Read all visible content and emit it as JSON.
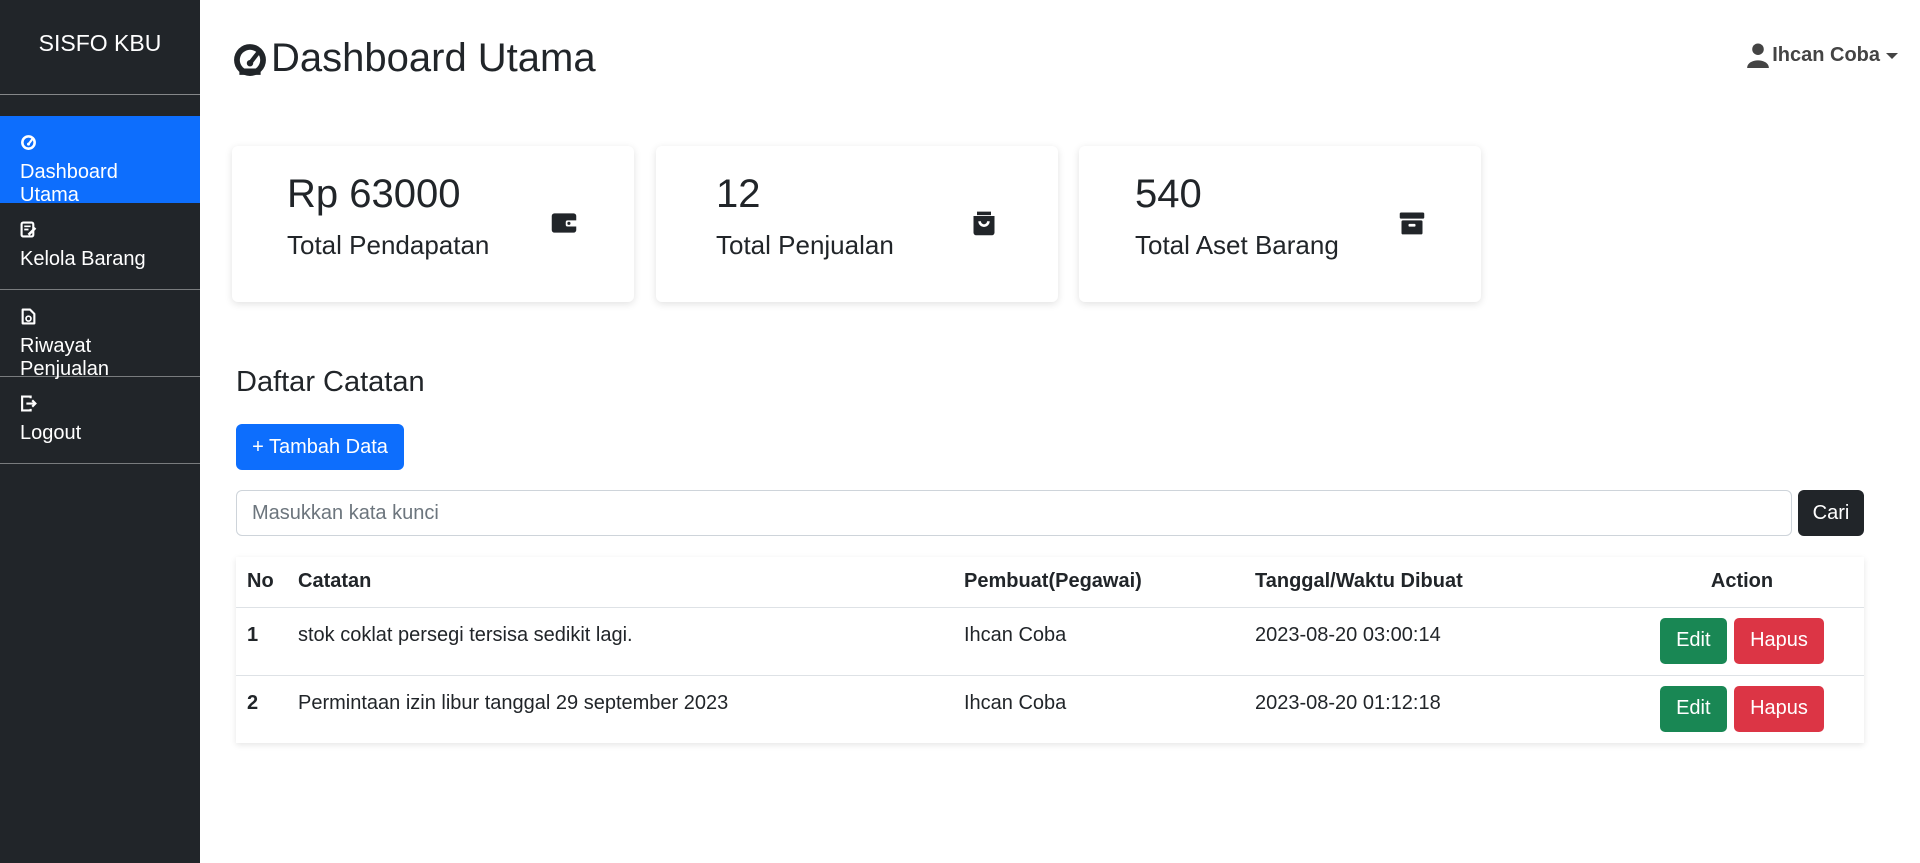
{
  "brand": "SISFO KBU",
  "sidebar": {
    "items": [
      {
        "label": "Dashboard Utama",
        "icon": "speedometer-icon",
        "active": true
      },
      {
        "label": "Kelola Barang",
        "icon": "edit-document-icon",
        "active": false
      },
      {
        "label": "Riwayat Penjualan",
        "icon": "history-document-icon",
        "active": false
      },
      {
        "label": "Logout",
        "icon": "logout-icon",
        "active": false
      }
    ]
  },
  "header": {
    "title": "Dashboard Utama",
    "user_name": "Ihcan Coba"
  },
  "stats": [
    {
      "value": "Rp 63000",
      "label": "Total Pendapatan",
      "icon": "wallet-icon"
    },
    {
      "value": "12",
      "label": "Total Penjualan",
      "icon": "shopping-bag-icon"
    },
    {
      "value": "540",
      "label": "Total Aset Barang",
      "icon": "archive-icon"
    }
  ],
  "notes": {
    "title": "Daftar Catatan",
    "add_label": "+ Tambah Data",
    "search_placeholder": "Masukkan kata kunci",
    "search_label": "Cari",
    "columns": [
      "No",
      "Catatan",
      "Pembuat(Pegawai)",
      "Tanggal/Waktu Dibuat",
      "Action"
    ],
    "rows": [
      {
        "no": "1",
        "note": "stok coklat persegi tersisa sedikit lagi.",
        "author": "Ihcan Coba",
        "created": "2023-08-20 03:00:14",
        "edit_label": "Edit",
        "delete_label": "Hapus"
      },
      {
        "no": "2",
        "note": "Permintaan izin libur tanggal 29 september 2023",
        "author": "Ihcan Coba",
        "created": "2023-08-20 01:12:18",
        "edit_label": "Edit",
        "delete_label": "Hapus"
      }
    ]
  },
  "colors": {
    "sidebar_bg": "#212529",
    "primary": "#0d6efd",
    "success": "#198754",
    "danger": "#dc3545"
  }
}
